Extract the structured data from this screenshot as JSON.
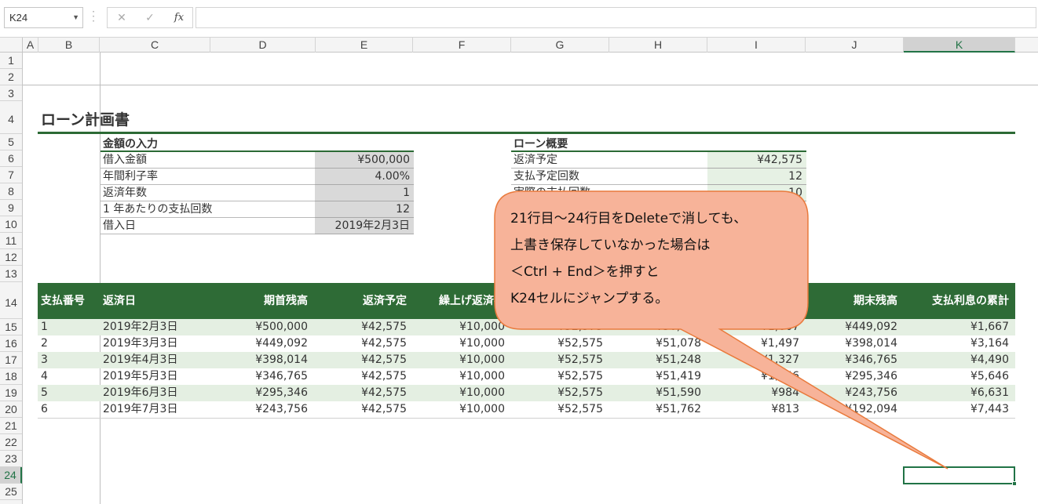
{
  "formula_bar": {
    "name_box": "K24",
    "cancel_glyph": "✕",
    "enter_glyph": "✓",
    "fx_label": "fx",
    "formula_value": ""
  },
  "columns": [
    "A",
    "B",
    "C",
    "D",
    "E",
    "F",
    "G",
    "H",
    "I",
    "J",
    "K"
  ],
  "selected_column": "K",
  "rows": [
    "1",
    "2",
    "3",
    "4",
    "5",
    "6",
    "7",
    "8",
    "9",
    "10",
    "11",
    "12",
    "13",
    "14",
    "15",
    "16",
    "17",
    "18",
    "19",
    "20",
    "21",
    "22",
    "23",
    "24",
    "25"
  ],
  "selected_row": "24",
  "sheet": {
    "title": "ローン計画書",
    "input_section": {
      "heading": "金額の入力",
      "items": [
        {
          "label": "借入金額",
          "value": "¥500,000"
        },
        {
          "label": "年間利子率",
          "value": "4.00%"
        },
        {
          "label": "返済年数",
          "value": "1"
        },
        {
          "label": "1 年あたりの支払回数",
          "value": "12"
        },
        {
          "label": "借入日",
          "value": "2019年2月3日"
        }
      ]
    },
    "summary_section": {
      "heading": "ローン概要",
      "items": [
        {
          "label": "返済予定",
          "value": "¥42,575"
        },
        {
          "label": "支払予定回数",
          "value": "12"
        },
        {
          "label": "実際の支払回数",
          "value": "10"
        }
      ]
    },
    "table": {
      "headers": [
        "支払番号",
        "返済日",
        "期首残高",
        "返済予定",
        "繰上げ返済額",
        "",
        "",
        "",
        "期末残高",
        "支払利息の累計"
      ],
      "rows": [
        [
          "1",
          "2019年2月3日",
          "¥500,000",
          "¥42,575",
          "¥10,000",
          "¥52,575",
          "¥50,908",
          "¥1,667",
          "¥449,092",
          "¥1,667"
        ],
        [
          "2",
          "2019年3月3日",
          "¥449,092",
          "¥42,575",
          "¥10,000",
          "¥52,575",
          "¥51,078",
          "¥1,497",
          "¥398,014",
          "¥3,164"
        ],
        [
          "3",
          "2019年4月3日",
          "¥398,014",
          "¥42,575",
          "¥10,000",
          "¥52,575",
          "¥51,248",
          "¥1,327",
          "¥346,765",
          "¥4,490"
        ],
        [
          "4",
          "2019年5月3日",
          "¥346,765",
          "¥42,575",
          "¥10,000",
          "¥52,575",
          "¥51,419",
          "¥1,156",
          "¥295,346",
          "¥5,646"
        ],
        [
          "5",
          "2019年6月3日",
          "¥295,346",
          "¥42,575",
          "¥10,000",
          "¥52,575",
          "¥51,590",
          "¥984",
          "¥243,756",
          "¥6,631"
        ],
        [
          "6",
          "2019年7月3日",
          "¥243,756",
          "¥42,575",
          "¥10,000",
          "¥52,575",
          "¥51,762",
          "¥813",
          "¥192,094",
          "¥7,443"
        ]
      ]
    }
  },
  "callout": {
    "lines": [
      "21行目～24行目をDeleteで消しても、",
      "上書き保存していなかった場合は",
      "＜Ctrl + End＞を押すと",
      "K24セルにジャンプする。"
    ],
    "fill_color": "#f7b399",
    "border_color": "#e97a3c"
  },
  "colors": {
    "accent_green": "#217346",
    "header_green": "#2e6b36",
    "band_green": "#e4efe2",
    "input_gray": "#d9d9d9"
  }
}
